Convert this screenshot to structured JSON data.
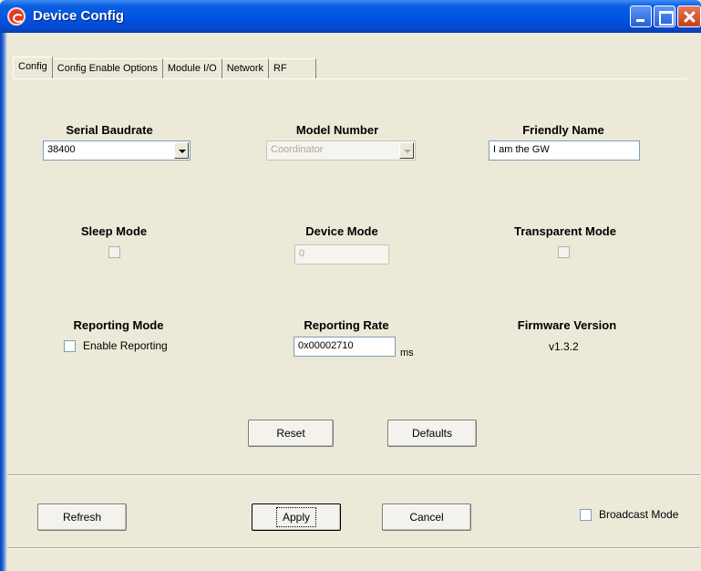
{
  "window": {
    "title": "Device Config"
  },
  "tabs": [
    "Config",
    "Config Enable Options",
    "Module I/O",
    "Network",
    "RF"
  ],
  "config": {
    "serial_baudrate": {
      "label": "Serial Baudrate",
      "value": "38400"
    },
    "model_number": {
      "label": "Model Number",
      "value": "Coordinator"
    },
    "friendly_name": {
      "label": "Friendly Name",
      "value": "I am the GW"
    },
    "sleep_mode": {
      "label": "Sleep Mode"
    },
    "device_mode": {
      "label": "Device Mode",
      "value": "0"
    },
    "transparent_mode": {
      "label": "Transparent Mode"
    },
    "reporting_mode": {
      "label": "Reporting Mode",
      "checkbox_label": "Enable Reporting"
    },
    "reporting_rate": {
      "label": "Reporting Rate",
      "value": "0x00002710",
      "unit": "ms"
    },
    "firmware_version": {
      "label": "Firmware Version",
      "value": "v1.3.2"
    },
    "reset_label": "Reset",
    "defaults_label": "Defaults"
  },
  "footer": {
    "refresh_label": "Refresh",
    "apply_label": "Apply",
    "cancel_label": "Cancel",
    "broadcast_label": "Broadcast Mode"
  }
}
